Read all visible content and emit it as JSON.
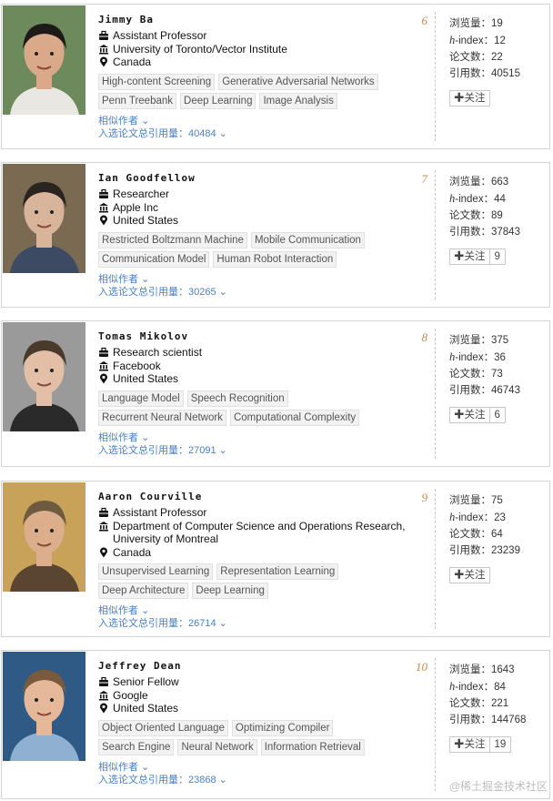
{
  "labels": {
    "views": "浏览量：",
    "hindex": "-index：",
    "hindex_h": "h",
    "papers": "论文数：",
    "citations": "引用数：",
    "follow": "关注",
    "similar": "相似作者",
    "cite_total": "入选论文总引用量："
  },
  "people": [
    {
      "name": "Jimmy Ba",
      "rank": "6",
      "title": "Assistant Professor",
      "org": "University of Toronto/Vector Institute",
      "location": "Canada",
      "tags": [
        "High-content Screening",
        "Generative Adversarial Networks",
        "Penn Treebank",
        "Deep Learning",
        "Image Analysis"
      ],
      "cite_total": "40484",
      "views": "19",
      "hindex": "12",
      "papers": "22",
      "citations": "40515",
      "follow_count": ""
    },
    {
      "name": "Ian Goodfellow",
      "rank": "7",
      "title": "Researcher",
      "org": "Apple Inc",
      "location": "United States",
      "tags": [
        "Restricted Boltzmann Machine",
        "Mobile Communication",
        "Communication Model",
        "Human Robot Interaction"
      ],
      "cite_total": "30265",
      "views": "663",
      "hindex": "44",
      "papers": "89",
      "citations": "37843",
      "follow_count": "9"
    },
    {
      "name": "Tomas Mikolov",
      "rank": "8",
      "title": "Research scientist",
      "org": "Facebook",
      "location": "United States",
      "tags": [
        "Language Model",
        "Speech Recognition",
        "Recurrent Neural Network",
        "Computational Complexity"
      ],
      "cite_total": "27091",
      "views": "375",
      "hindex": "36",
      "papers": "73",
      "citations": "46743",
      "follow_count": "6"
    },
    {
      "name": "Aaron Courville",
      "rank": "9",
      "title": "Assistant Professor",
      "org": "Department of Computer Science and Operations Research, University of Montreal",
      "location": "Canada",
      "tags": [
        "Unsupervised Learning",
        "Representation Learning",
        "Deep Architecture",
        "Deep Learning"
      ],
      "cite_total": "26714",
      "views": "75",
      "hindex": "23",
      "papers": "64",
      "citations": "23239",
      "follow_count": ""
    },
    {
      "name": "Jeffrey Dean",
      "rank": "10",
      "title": "Senior Fellow",
      "org": "Google",
      "location": "United States",
      "tags": [
        "Object Oriented Language",
        "Optimizing Compiler",
        "Search Engine",
        "Neural Network",
        "Information Retrieval"
      ],
      "cite_total": "23868",
      "views": "1643",
      "hindex": "84",
      "papers": "221",
      "citations": "144768",
      "follow_count": "19"
    }
  ],
  "watermark": "@稀土掘金技术社区",
  "colors": {
    "accent": "#4a7fc1",
    "rank": "#c08a55",
    "border": "#d4d4d4"
  }
}
